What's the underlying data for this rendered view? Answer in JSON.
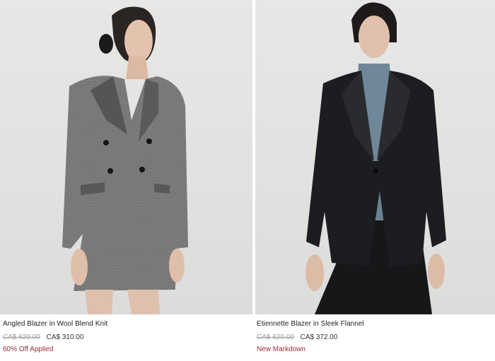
{
  "products": [
    {
      "name": "Angled Blazer in Wool Blend Knit",
      "original_price": "CA$ 620.00",
      "sale_price": "CA$ 310.00",
      "promo": "60% Off Applied"
    },
    {
      "name": "Etiennette Blazer in Sleek Flannel",
      "original_price": "CA$ 620.00",
      "sale_price": "CA$ 372.00",
      "promo": "New Markdown"
    }
  ],
  "colors": {
    "promo_red": "#a12a34",
    "strike_gray": "#9a9a9a",
    "photo_bg": "#e3e3e2"
  }
}
